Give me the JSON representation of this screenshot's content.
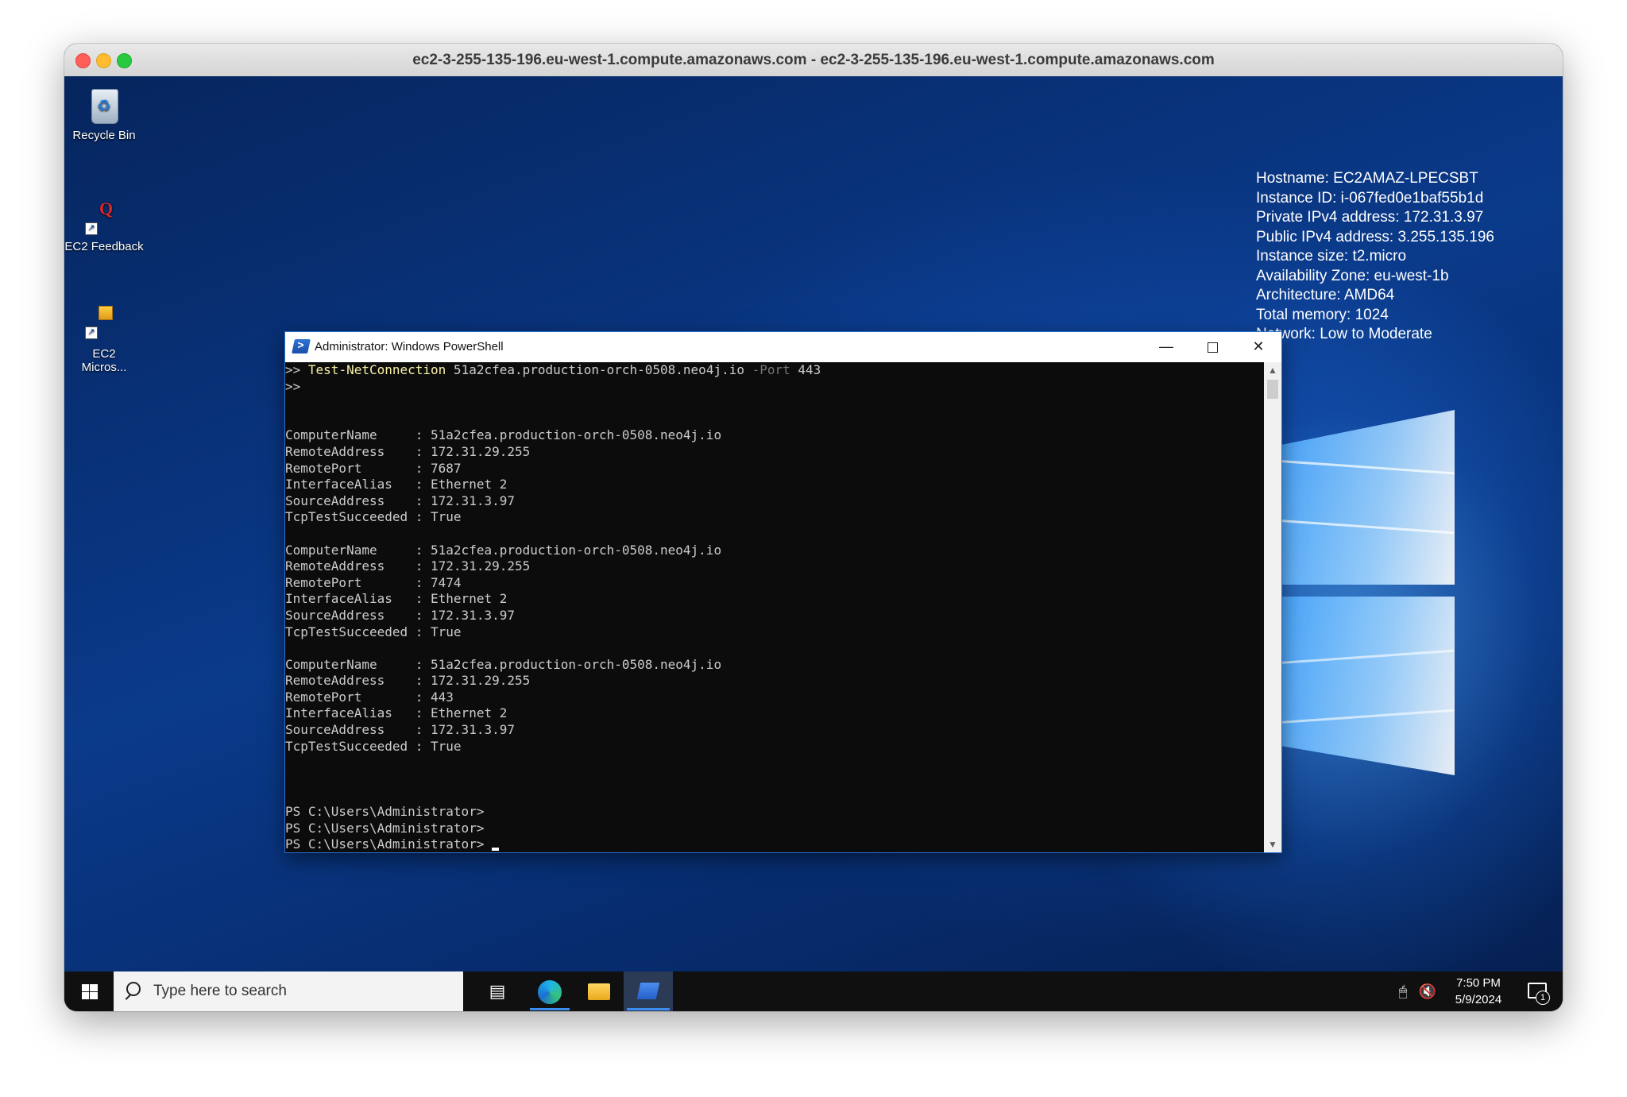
{
  "mac_window": {
    "title": "ec2-3-255-135-196.eu-west-1.compute.amazonaws.com - ec2-3-255-135-196.eu-west-1.compute.amazonaws.com"
  },
  "desktop": {
    "icons": [
      {
        "label": "Recycle Bin",
        "icon": "recycle-bin-icon"
      },
      {
        "label": "EC2 Feedback",
        "icon": "feedback-icon"
      },
      {
        "label": "EC2 Micros...",
        "icon": "package-icon"
      }
    ],
    "info": {
      "hostname": "Hostname: EC2AMAZ-LPECSBT",
      "instance_id": "Instance ID: i-067fed0e1baf55b1d",
      "private_ip": "Private IPv4 address: 172.31.3.97",
      "public_ip": "Public IPv4 address: 3.255.135.196",
      "instance_size": "Instance size: t2.micro",
      "availability_zone": "Availability Zone: eu-west-1b",
      "architecture": "Architecture: AMD64",
      "total_memory": "Total memory: 1024",
      "network": "Network: Low to Moderate"
    }
  },
  "powershell": {
    "title": "Administrator: Windows PowerShell",
    "command": {
      "prompt": ">> ",
      "cmd": "Test-NetConnection",
      "target": " 51a2cfea.production-orch-0508.neo4j.io ",
      "param": "-Port",
      "port": " 443"
    },
    "lines": [
      ">>",
      "",
      "",
      "ComputerName     : 51a2cfea.production-orch-0508.neo4j.io",
      "RemoteAddress    : 172.31.29.255",
      "RemotePort       : 7687",
      "InterfaceAlias   : Ethernet 2",
      "SourceAddress    : 172.31.3.97",
      "TcpTestSucceeded : True",
      "",
      "ComputerName     : 51a2cfea.production-orch-0508.neo4j.io",
      "RemoteAddress    : 172.31.29.255",
      "RemotePort       : 7474",
      "InterfaceAlias   : Ethernet 2",
      "SourceAddress    : 172.31.3.97",
      "TcpTestSucceeded : True",
      "",
      "ComputerName     : 51a2cfea.production-orch-0508.neo4j.io",
      "RemoteAddress    : 172.31.29.255",
      "RemotePort       : 443",
      "InterfaceAlias   : Ethernet 2",
      "SourceAddress    : 172.31.3.97",
      "TcpTestSucceeded : True",
      "",
      "",
      "",
      "PS C:\\Users\\Administrator>",
      "PS C:\\Users\\Administrator>"
    ],
    "last_prompt": "PS C:\\Users\\Administrator> "
  },
  "taskbar": {
    "search_placeholder": "Type here to search",
    "time": "7:50 PM",
    "date": "5/9/2024",
    "notification_count": "1",
    "apps": [
      "task-view-icon",
      "edge-icon",
      "file-explorer-icon",
      "powershell-icon"
    ],
    "colors": {
      "taskbar": "#101010",
      "accent": "#3c8cf0"
    }
  }
}
